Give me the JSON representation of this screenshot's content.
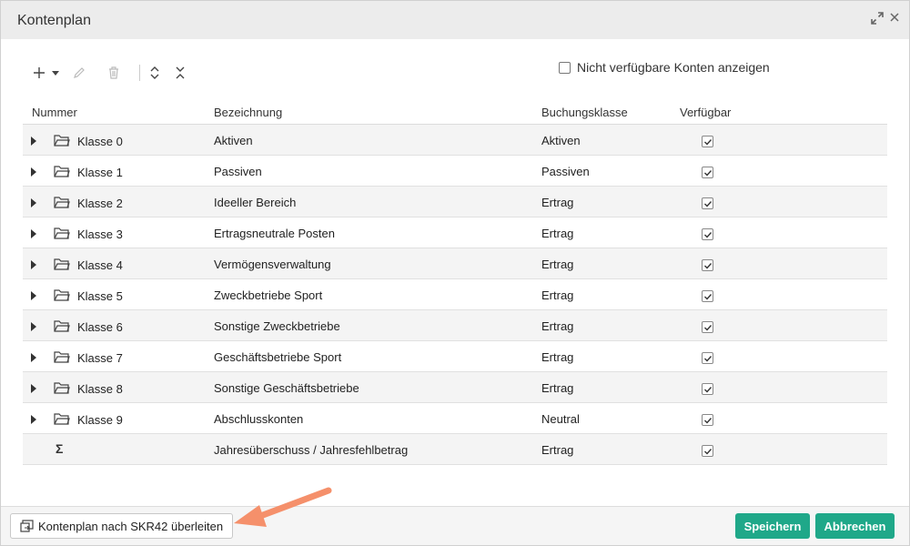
{
  "dialog": {
    "title": "Kontenplan"
  },
  "toolbar": {
    "add_icon": "plus-icon",
    "dropdown_icon": "caret-down-icon",
    "edit_icon": "pencil-icon",
    "delete_icon": "trash-icon",
    "expand_all_icon": "expand-all-icon",
    "collapse_all_icon": "collapse-all-icon"
  },
  "filter": {
    "show_unavailable_label": "Nicht verfügbare Konten anzeigen",
    "checked": false
  },
  "table": {
    "columns": [
      "Nummer",
      "Bezeichnung",
      "Buchungsklasse",
      "Verfügbar"
    ],
    "rows": [
      {
        "nummer": "Klasse 0",
        "bezeichnung": "Aktiven",
        "buchungsklasse": "Aktiven",
        "verfuegbar": true
      },
      {
        "nummer": "Klasse 1",
        "bezeichnung": "Passiven",
        "buchungsklasse": "Passiven",
        "verfuegbar": true
      },
      {
        "nummer": "Klasse 2",
        "bezeichnung": "Ideeller Bereich",
        "buchungsklasse": "Ertrag",
        "verfuegbar": true
      },
      {
        "nummer": "Klasse 3",
        "bezeichnung": "Ertragsneutrale Posten",
        "buchungsklasse": "Ertrag",
        "verfuegbar": true
      },
      {
        "nummer": "Klasse 4",
        "bezeichnung": "Vermögensverwaltung",
        "buchungsklasse": "Ertrag",
        "verfuegbar": true
      },
      {
        "nummer": "Klasse 5",
        "bezeichnung": "Zweckbetriebe Sport",
        "buchungsklasse": "Ertrag",
        "verfuegbar": true
      },
      {
        "nummer": "Klasse 6",
        "bezeichnung": "Sonstige Zweckbetriebe",
        "buchungsklasse": "Ertrag",
        "verfuegbar": true
      },
      {
        "nummer": "Klasse 7",
        "bezeichnung": "Geschäftsbetriebe Sport",
        "buchungsklasse": "Ertrag",
        "verfuegbar": true
      },
      {
        "nummer": "Klasse 8",
        "bezeichnung": "Sonstige Geschäftsbetriebe",
        "buchungsklasse": "Ertrag",
        "verfuegbar": true
      },
      {
        "nummer": "Klasse 9",
        "bezeichnung": "Abschlusskonten",
        "buchungsklasse": "Neutral",
        "verfuegbar": true
      }
    ],
    "summary_row": {
      "icon": "sigma-icon",
      "bezeichnung": "Jahresüberschuss / Jahresfehlbetrag",
      "buchungsklasse": "Ertrag",
      "verfuegbar": true
    }
  },
  "footer": {
    "migrate_label": "Kontenplan nach SKR42 überleiten",
    "save_label": "Speichern",
    "cancel_label": "Abbrechen"
  },
  "colors": {
    "primary": "#1fa889",
    "annotation_arrow": "#f5906b"
  }
}
